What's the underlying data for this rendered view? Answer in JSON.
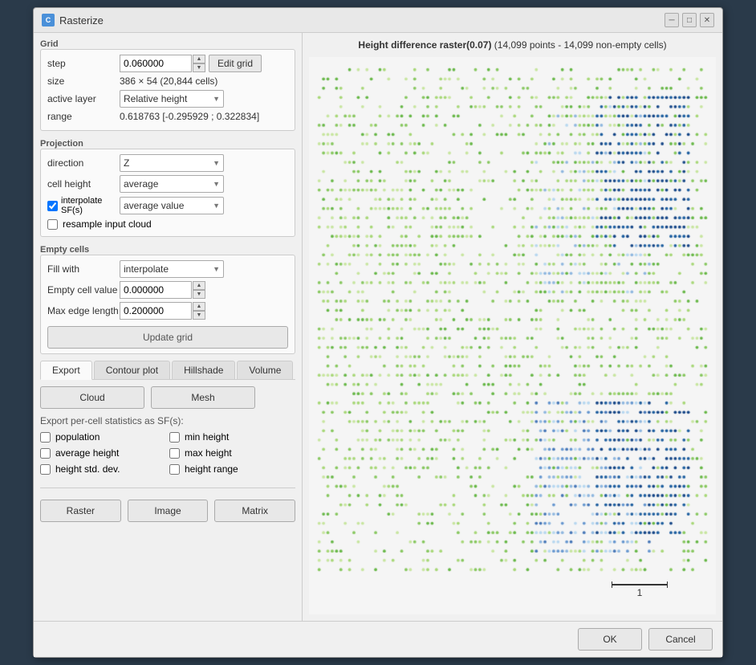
{
  "titlebar": {
    "icon": "C",
    "title": "Rasterize",
    "minimize_label": "─",
    "maximize_label": "□",
    "close_label": "✕"
  },
  "grid_section": {
    "label": "Grid",
    "step_label": "step",
    "step_value": "0.060000",
    "edit_grid_label": "Edit grid",
    "size_label": "size",
    "size_value": "386 × 54 (20,844 cells)",
    "active_layer_label": "active layer",
    "active_layer_value": "Relative height",
    "range_label": "range",
    "range_value": "0.618763 [-0.295929 ; 0.322834]"
  },
  "projection_section": {
    "label": "Projection",
    "direction_label": "direction",
    "direction_value": "Z",
    "cell_height_label": "cell height",
    "cell_height_value": "average",
    "interpolate_label": "interpolate SF(s)",
    "interpolate_checked": true,
    "interpolate_value": "average value",
    "resample_label": "resample input cloud"
  },
  "empty_cells_section": {
    "label": "Empty cells",
    "fill_with_label": "Fill with",
    "fill_with_value": "interpolate",
    "empty_cell_value_label": "Empty cell value",
    "empty_cell_value": "0.000000",
    "max_edge_length_label": "Max edge length",
    "max_edge_length_value": "0.200000",
    "update_grid_label": "Update grid"
  },
  "tabs": [
    {
      "id": "export",
      "label": "Export",
      "active": true
    },
    {
      "id": "contour_plot",
      "label": "Contour plot",
      "active": false
    },
    {
      "id": "hillshade",
      "label": "Hillshade",
      "active": false
    },
    {
      "id": "volume",
      "label": "Volume",
      "active": false
    }
  ],
  "export_section": {
    "cloud_label": "Cloud",
    "mesh_label": "Mesh",
    "stats_label": "Export per-cell statistics as SF(s):",
    "stats": [
      {
        "id": "population",
        "label": "population",
        "checked": false
      },
      {
        "id": "min_height",
        "label": "min height",
        "checked": false
      },
      {
        "id": "average_height",
        "label": "average height",
        "checked": false
      },
      {
        "id": "max_height",
        "label": "max height",
        "checked": false
      },
      {
        "id": "height_std_dev",
        "label": "height std. dev.",
        "checked": false
      },
      {
        "id": "height_range",
        "label": "height range",
        "checked": false
      }
    ]
  },
  "bottom_buttons": [
    {
      "id": "raster",
      "label": "Raster"
    },
    {
      "id": "image",
      "label": "Image"
    },
    {
      "id": "matrix",
      "label": "Matrix"
    }
  ],
  "footer": {
    "ok_label": "OK",
    "cancel_label": "Cancel"
  },
  "raster_view": {
    "title_bold": "Height difference raster(0.07)",
    "title_normal": " (14,099 points - 14,099 non-empty cells)",
    "scale_value": "1"
  }
}
